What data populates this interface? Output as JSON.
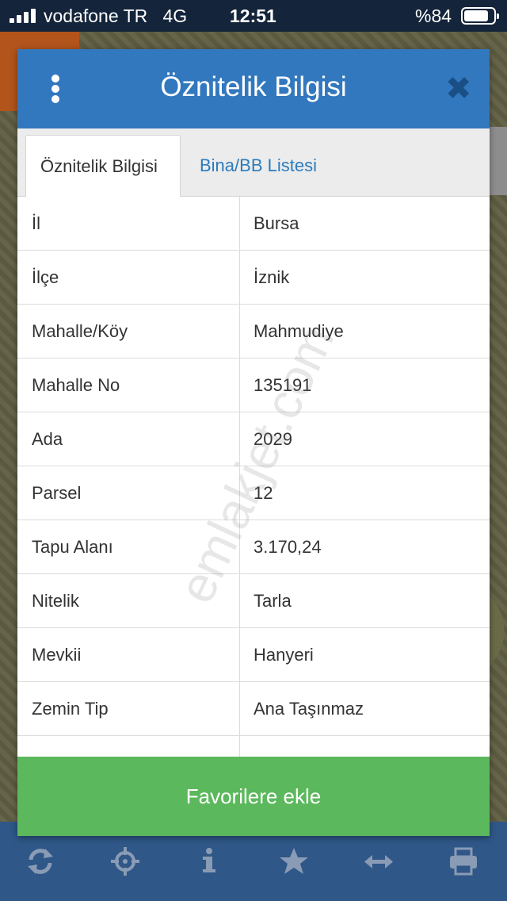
{
  "status_bar": {
    "carrier": "vodafone TR",
    "network": "4G",
    "time": "12:51",
    "battery": "%84"
  },
  "modal": {
    "title": "Öznitelik Bilgisi",
    "close_symbol": "✖",
    "tabs": [
      {
        "label": "Öznitelik Bilgisi",
        "active": true
      },
      {
        "label": "Bina/BB Listesi",
        "active": false
      }
    ],
    "rows": [
      {
        "key": "İl",
        "value": "Bursa"
      },
      {
        "key": "İlçe",
        "value": "İznik"
      },
      {
        "key": "Mahalle/Köy",
        "value": "Mahmudiye"
      },
      {
        "key": "Mahalle No",
        "value": "135191"
      },
      {
        "key": "Ada",
        "value": "2029"
      },
      {
        "key": "Parsel",
        "value": "12"
      },
      {
        "key": "Tapu Alanı",
        "value": "3.170,24"
      },
      {
        "key": "Nitelik",
        "value": "Tarla"
      },
      {
        "key": "Mevkii",
        "value": "Hanyeri"
      },
      {
        "key": "Zemin Tip",
        "value": "Ana Taşınmaz"
      }
    ],
    "favorite_button": "Favorilere ekle"
  },
  "watermark": "emlakjet.com",
  "toolbar": {
    "icons": [
      "refresh-icon",
      "crosshair-icon",
      "info-icon",
      "star-icon",
      "measure-icon",
      "print-icon"
    ]
  },
  "colors": {
    "header": "#3278be",
    "tab_link": "#2b7bbd",
    "favorite": "#5cb85c",
    "toolbar": "#2f5787",
    "toolbar_icon": "#8a9bb5"
  }
}
